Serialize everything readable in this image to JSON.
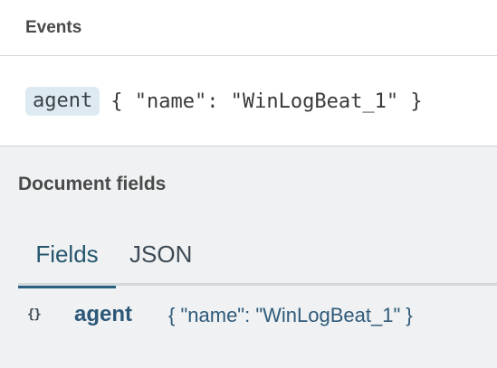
{
  "header": {
    "title": "Events"
  },
  "event": {
    "field": "agent",
    "value": "{ \"name\": \"WinLogBeat_1\" }"
  },
  "document_fields": {
    "title": "Document fields",
    "tabs": [
      {
        "label": "Fields",
        "active": true
      },
      {
        "label": "JSON",
        "active": false
      }
    ],
    "rows": [
      {
        "icon": "braces-icon",
        "name": "agent",
        "value": "{ \"name\": \"WinLogBeat_1\" }"
      }
    ]
  },
  "colors": {
    "accent": "#2a6183",
    "chip_bg": "#deeaf2",
    "panel_bg": "#eff1f2"
  }
}
